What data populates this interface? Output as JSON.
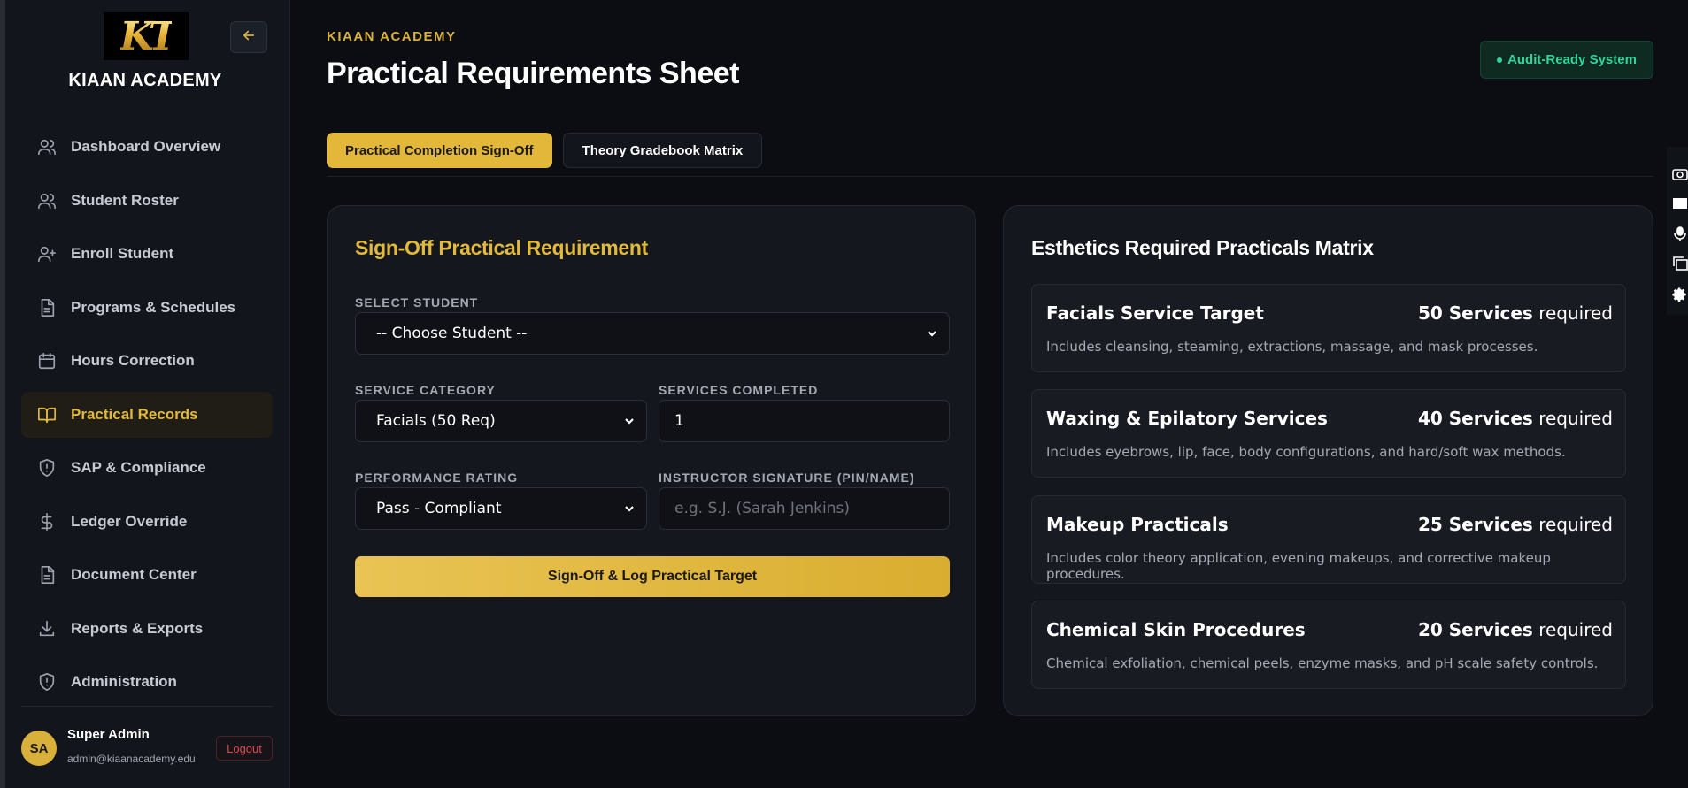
{
  "brand": {
    "logo_text": "KT",
    "name": "KIAAN ACADEMY"
  },
  "sidebar": {
    "items": [
      {
        "label": "Dashboard Overview",
        "icon": "users-icon"
      },
      {
        "label": "Student Roster",
        "icon": "users-icon"
      },
      {
        "label": "Enroll Student",
        "icon": "user-plus-icon"
      },
      {
        "label": "Programs & Schedules",
        "icon": "document-icon"
      },
      {
        "label": "Hours Correction",
        "icon": "calendar-icon"
      },
      {
        "label": "Practical Records",
        "icon": "book-icon",
        "active": true
      },
      {
        "label": "SAP & Compliance",
        "icon": "shield-icon"
      },
      {
        "label": "Ledger Override",
        "icon": "dollar-icon"
      },
      {
        "label": "Document Center",
        "icon": "document-icon"
      },
      {
        "label": "Reports & Exports",
        "icon": "download-icon"
      },
      {
        "label": "Administration",
        "icon": "shield-icon"
      }
    ],
    "user": {
      "initials": "SA",
      "name": "Super Admin",
      "email": "admin@kiaanacademy.edu",
      "logout_label": "Logout"
    }
  },
  "header": {
    "eyebrow": "KIAAN ACADEMY",
    "title": "Practical Requirements Sheet",
    "badge": "Audit-Ready System"
  },
  "tabs": [
    {
      "label": "Practical Completion Sign-Off",
      "active": true
    },
    {
      "label": "Theory Gradebook Matrix",
      "active": false
    }
  ],
  "signoff_form": {
    "title": "Sign-Off Practical Requirement",
    "student_label": "SELECT STUDENT",
    "student_value": "-- Choose Student --",
    "category_label": "SERVICE CATEGORY",
    "category_value": "Facials (50 Req)",
    "completed_label": "SERVICES COMPLETED",
    "completed_value": "1",
    "rating_label": "PERFORMANCE RATING",
    "rating_value": "Pass - Compliant",
    "signature_label": "INSTRUCTOR SIGNATURE (PIN/NAME)",
    "signature_placeholder": "e.g. S.J. (Sarah Jenkins)",
    "submit_label": "Sign-Off & Log Practical Target"
  },
  "matrix": {
    "title": "Esthetics Required Practicals Matrix",
    "required_word": "required",
    "items": [
      {
        "name": "Facials Service Target",
        "count": "50 Services",
        "description": "Includes cleansing, steaming, extractions, massage, and mask processes."
      },
      {
        "name": "Waxing & Epilatory Services",
        "count": "40 Services",
        "description": "Includes eyebrows, lip, face, body configurations, and hard/soft wax methods."
      },
      {
        "name": "Makeup Practicals",
        "count": "25 Services",
        "description": "Includes color theory application, evening makeups, and corrective makeup procedures."
      },
      {
        "name": "Chemical Skin Procedures",
        "count": "20 Services",
        "description": "Chemical exfoliation, chemical peels, enzyme masks, and pH scale safety controls."
      }
    ]
  },
  "colors": {
    "accent_gold": "#e2b93b",
    "success_green": "#34d399",
    "danger_red": "#e0484f",
    "background": "#0b0d12"
  }
}
